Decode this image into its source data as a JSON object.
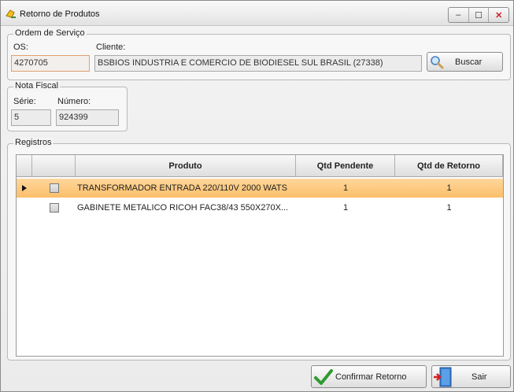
{
  "window": {
    "title": "Retorno de Produtos",
    "controls": {
      "minimize": "–",
      "maximize": "☐",
      "close": "✕"
    }
  },
  "ordem_servico": {
    "legend": "Ordem de Serviço",
    "os_label": "OS:",
    "os_value": "4270705",
    "cliente_label": "Cliente:",
    "cliente_value": "BSBIOS INDUSTRIA E COMERCIO DE BIODIESEL SUL BRASIL (27338)",
    "search_button": "Buscar"
  },
  "nota_fiscal": {
    "legend": "Nota Fiscal",
    "serie_label": "Série:",
    "serie_value": "5",
    "numero_label": "Número:",
    "numero_value": "924399"
  },
  "registros": {
    "legend": "Registros",
    "columns": {
      "produto": "Produto",
      "qtd_pendente": "Qtd Pendente",
      "qtd_retorno": "Qtd de Retorno"
    },
    "rows": [
      {
        "produto": "TRANSFORMADOR ENTRADA 220/110V 2000 WATS",
        "qtd_pendente": "1",
        "qtd_retorno": "1",
        "selected": true,
        "checked": false
      },
      {
        "produto": "GABINETE  METALICO  RICOH  FAC38/43  550X270X...",
        "qtd_pendente": "1",
        "qtd_retorno": "1",
        "selected": false,
        "checked": false
      }
    ]
  },
  "footer": {
    "confirm_button": "Confirmar Retorno",
    "exit_button": "Sair"
  }
}
